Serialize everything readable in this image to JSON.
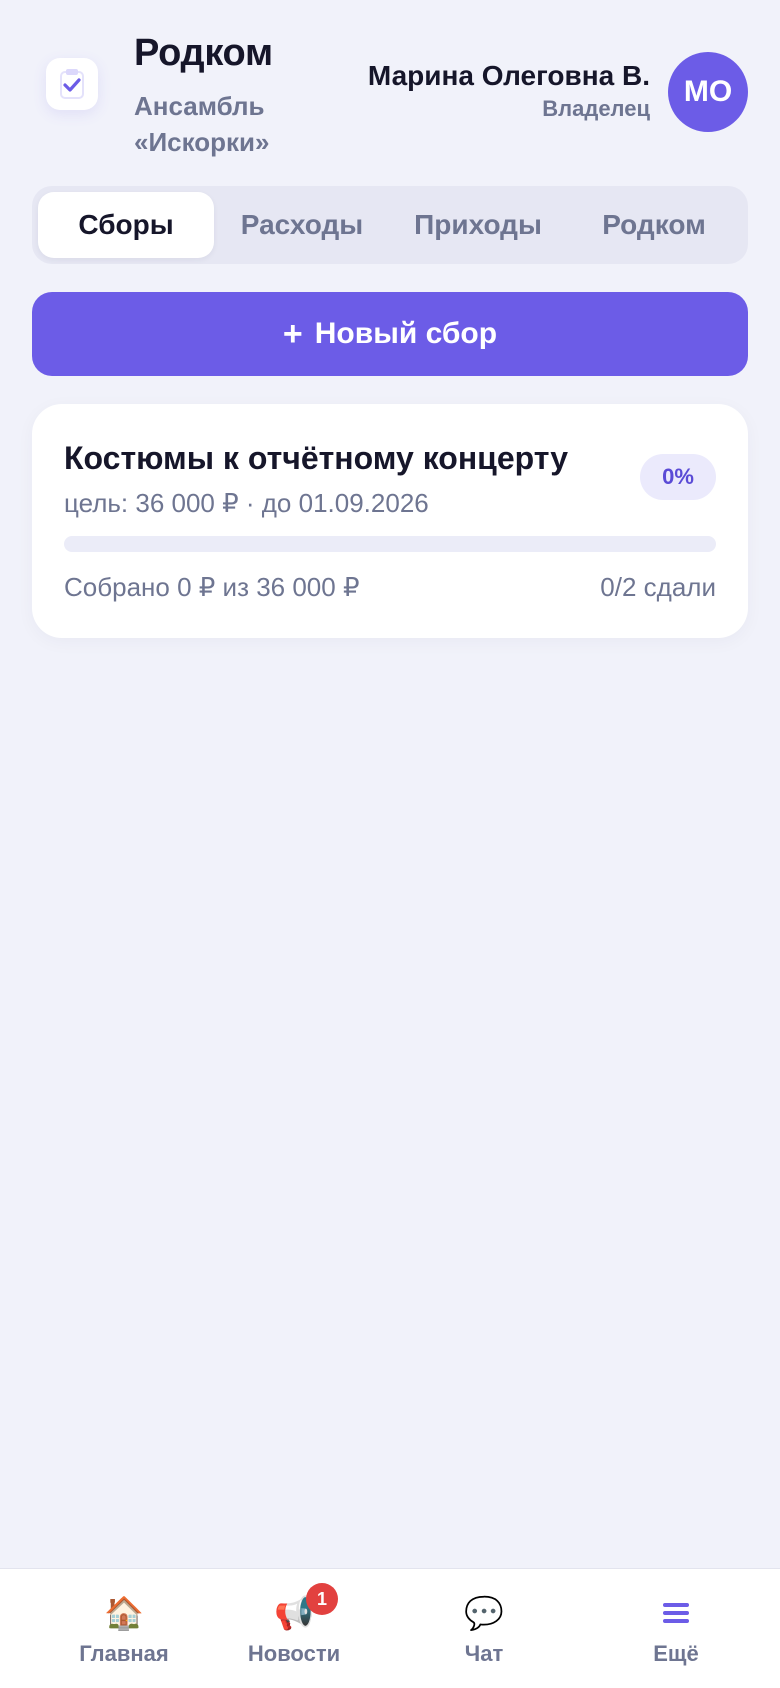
{
  "header": {
    "app_title": "Родком",
    "subtitle": "Ансамбль «Искорки»",
    "user_name": "Марина Олеговна В.",
    "user_role": "Владелец",
    "avatar_initials": "МО"
  },
  "tabs": [
    {
      "label": "Сборы",
      "active": true
    },
    {
      "label": "Расходы",
      "active": false
    },
    {
      "label": "Приходы",
      "active": false
    },
    {
      "label": "Родком",
      "active": false
    }
  ],
  "new_collection_button": {
    "plus": "+",
    "label": "Новый сбор"
  },
  "collections": [
    {
      "title": "Костюмы к отчётному концерту",
      "meta": "цель: 36 000 ₽ · до 01.09.2026",
      "percent_label": "0%",
      "progress_fraction": 0,
      "collected": "Собрано 0 ₽ из 36 000 ₽",
      "paid": "0/2 сдали"
    }
  ],
  "bottom_nav": [
    {
      "label": "Главная",
      "icon": "house-icon",
      "glyph": "🏠",
      "active": false,
      "badge": ""
    },
    {
      "label": "Новости",
      "icon": "megaphone-icon",
      "glyph": "📢",
      "active": false,
      "badge": "1"
    },
    {
      "label": "Чат",
      "icon": "speech-bubble-icon",
      "glyph": "💬",
      "active": false,
      "badge": ""
    },
    {
      "label": "Ещё",
      "icon": "menu-icon",
      "glyph": "≡",
      "active": true,
      "badge": ""
    }
  ],
  "colors": {
    "accent": "#6c5ce7",
    "background": "#f1f2fa",
    "badge_red": "#e2413f",
    "muted_text": "#6e7591"
  }
}
